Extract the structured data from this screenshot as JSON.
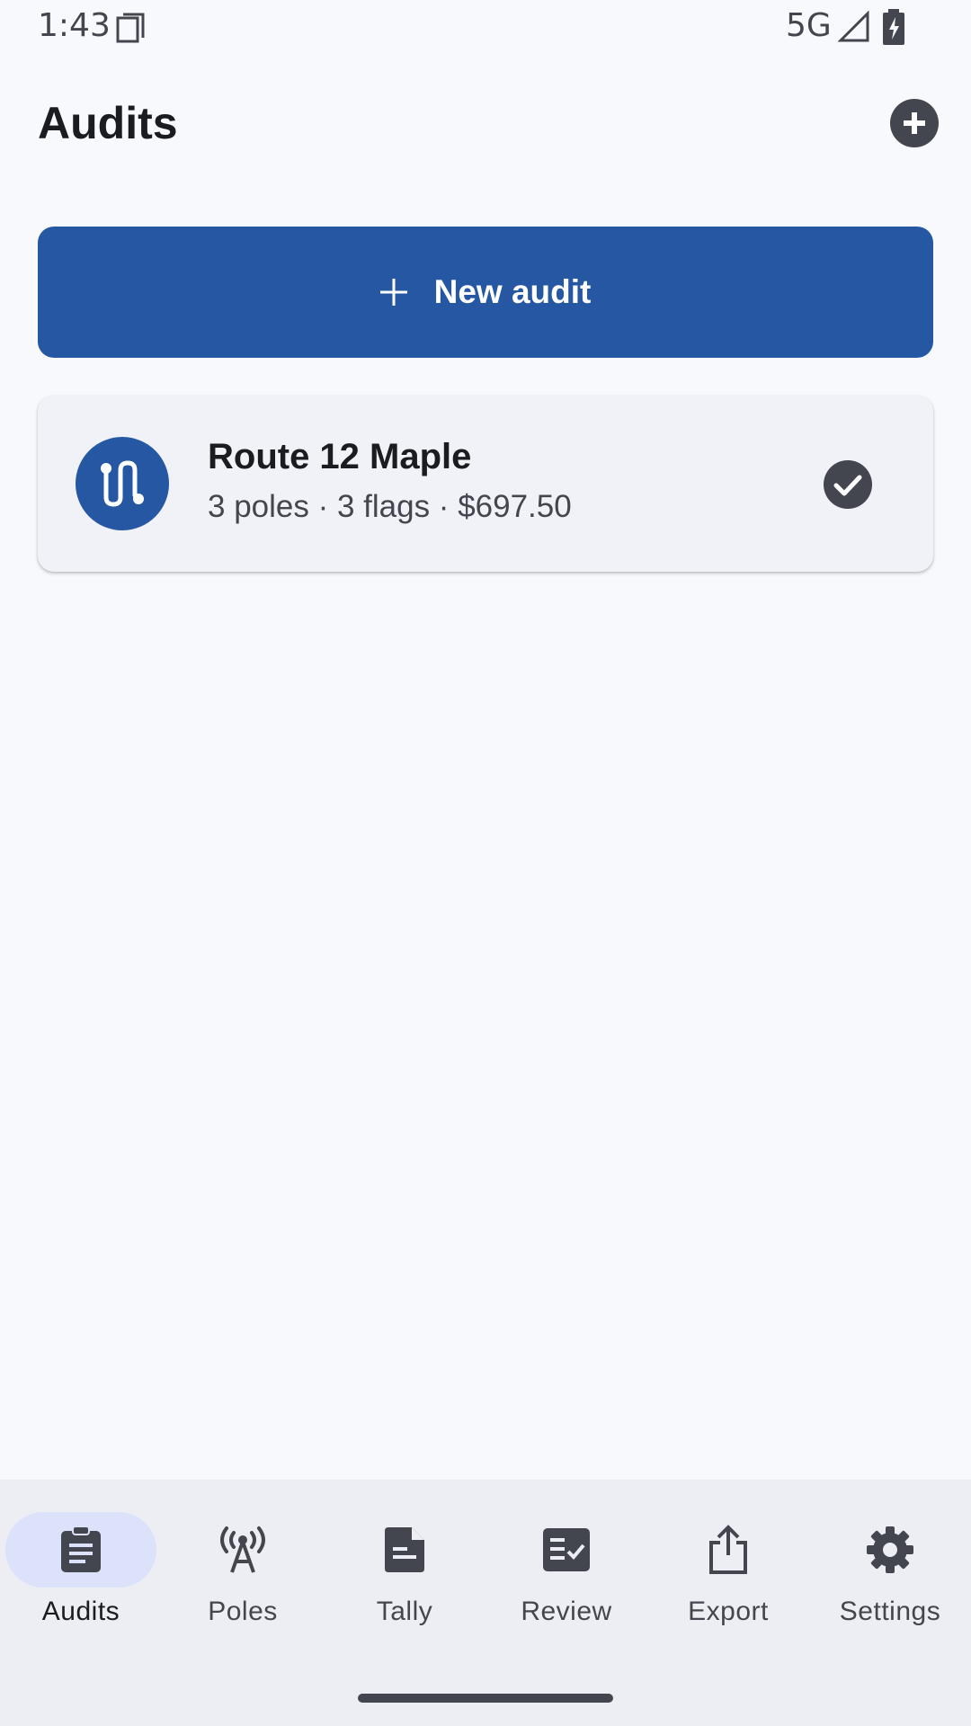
{
  "status_bar": {
    "time": "1:43",
    "network": "5G",
    "icons": [
      "sim-card-icon",
      "signal-icon",
      "battery-charging-icon"
    ]
  },
  "header": {
    "title": "Audits",
    "action_icon": "add-circle-icon"
  },
  "new_audit_button": {
    "label": "New audit",
    "icon": "plus-icon"
  },
  "audits": [
    {
      "title": "Route 12 Maple",
      "subtitle": "3 poles · 3 flags · $697.50",
      "icon": "route-icon",
      "status_icon": "check-circle-icon"
    }
  ],
  "bottom_nav": {
    "active": "Audits",
    "items": [
      {
        "label": "Audits",
        "icon": "clipboard-icon"
      },
      {
        "label": "Poles",
        "icon": "antenna-icon"
      },
      {
        "label": "Tally",
        "icon": "document-icon"
      },
      {
        "label": "Review",
        "icon": "checklist-icon"
      },
      {
        "label": "Export",
        "icon": "share-icon"
      },
      {
        "label": "Settings",
        "icon": "gear-icon"
      }
    ]
  },
  "colors": {
    "primary": "#2557a3",
    "background": "#f8f9fd",
    "card": "#f1f2f8",
    "nav_background": "#edeef4",
    "nav_active_pill": "#dbe2f9",
    "icon_dark": "#44464f"
  }
}
